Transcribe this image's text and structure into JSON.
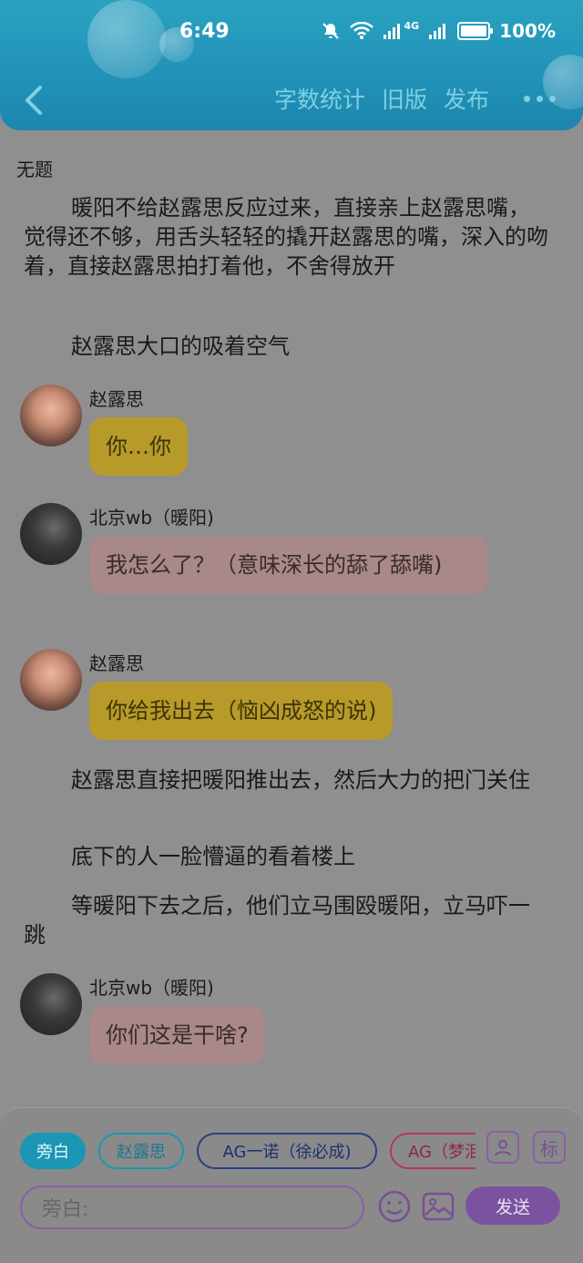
{
  "status_bar": {
    "time": "6:49",
    "battery": "100%",
    "network": "4G"
  },
  "nav": {
    "word_count": "字数统计",
    "old_version": "旧版",
    "publish": "发布"
  },
  "story": {
    "title": "无题",
    "paragraphs": [
      "暖阳不给赵露思反应过来，直接亲上赵露思嘴，觉得还不够，用舌头轻轻的撬开赵露思的嘴，深入的吻着，直接赵露思拍打着他，不舍得放开",
      "赵露思大口的吸着空气",
      "赵露思直接把暖阳推出去，然后大力的把门关住",
      "底下的人一脸懵逼的看着楼上",
      "等暖阳下去之后，他们立马围殴暖阳，立马吓一跳"
    ],
    "messages": [
      {
        "sender": "赵露思",
        "text": "你…你"
      },
      {
        "sender": "北京wb（暖阳)",
        "text": "我怎么了？（意味深长的舔了舔嘴)"
      },
      {
        "sender": "赵露思",
        "text": "你给我出去（恼凶成怒的说)"
      },
      {
        "sender": "北京wb（暖阳)",
        "text": "你们这是干啥?"
      }
    ]
  },
  "composer": {
    "roles": [
      "旁白",
      "赵露思",
      "AG一诺（徐必成)",
      "AG（梦泪"
    ],
    "tag_icon_label": "标",
    "input_placeholder": "旁白:",
    "send_label": "发送"
  },
  "colors": {
    "header": "#2293b8",
    "accent_purple": "#7b52a0",
    "bubble_yellow": "#b89a2a",
    "bubble_pink": "#a88888"
  }
}
